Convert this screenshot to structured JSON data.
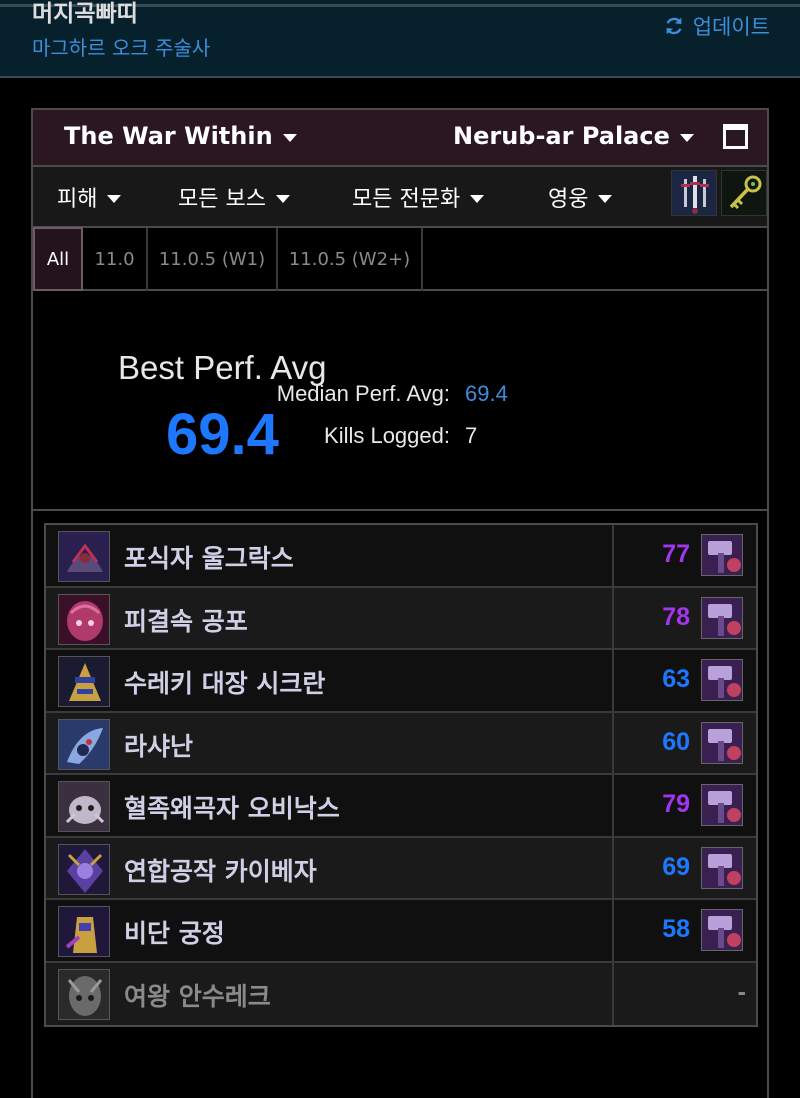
{
  "header": {
    "character_name": "머지곡빠띠",
    "character_subtitle": "마그하르 오크 주술사",
    "update_label": "업데이트",
    "refresh_icon": "refresh-icon"
  },
  "filters": {
    "expansion": "The War Within",
    "zone": "Nerub-ar Palace",
    "metric": "피해",
    "boss": "모든 보스",
    "spec": "모든 전문화",
    "difficulty": "영웅"
  },
  "patch_tabs": [
    "All",
    "11.0",
    "11.0.5 (W1)",
    "11.0.5 (W2+)"
  ],
  "summary": {
    "best_label": "Best Perf. Avg",
    "best_value": "69.4",
    "median_label": "Median Perf. Avg:",
    "median_value": "69.4",
    "kills_label": "Kills Logged:",
    "kills_value": "7"
  },
  "bosses": [
    {
      "name": "포식자 울그락스",
      "score": "77",
      "quality": "purple"
    },
    {
      "name": "피결속 공포",
      "score": "78",
      "quality": "purple"
    },
    {
      "name": "수레키 대장 시크란",
      "score": "63",
      "quality": "blue"
    },
    {
      "name": "라샤난",
      "score": "60",
      "quality": "blue"
    },
    {
      "name": "혈족왜곡자 오비낙스",
      "score": "79",
      "quality": "purple"
    },
    {
      "name": "연합공작 카이베자",
      "score": "69",
      "quality": "blue"
    },
    {
      "name": "비단 궁정",
      "score": "58",
      "quality": "blue"
    },
    {
      "name": "여왕 안수레크",
      "score": "-",
      "quality": "gray"
    }
  ],
  "colors": {
    "purple": "#a335ee",
    "blue": "#1d78ff",
    "accent_link": "#3d8ddb",
    "panel_header": "#2a1722"
  }
}
